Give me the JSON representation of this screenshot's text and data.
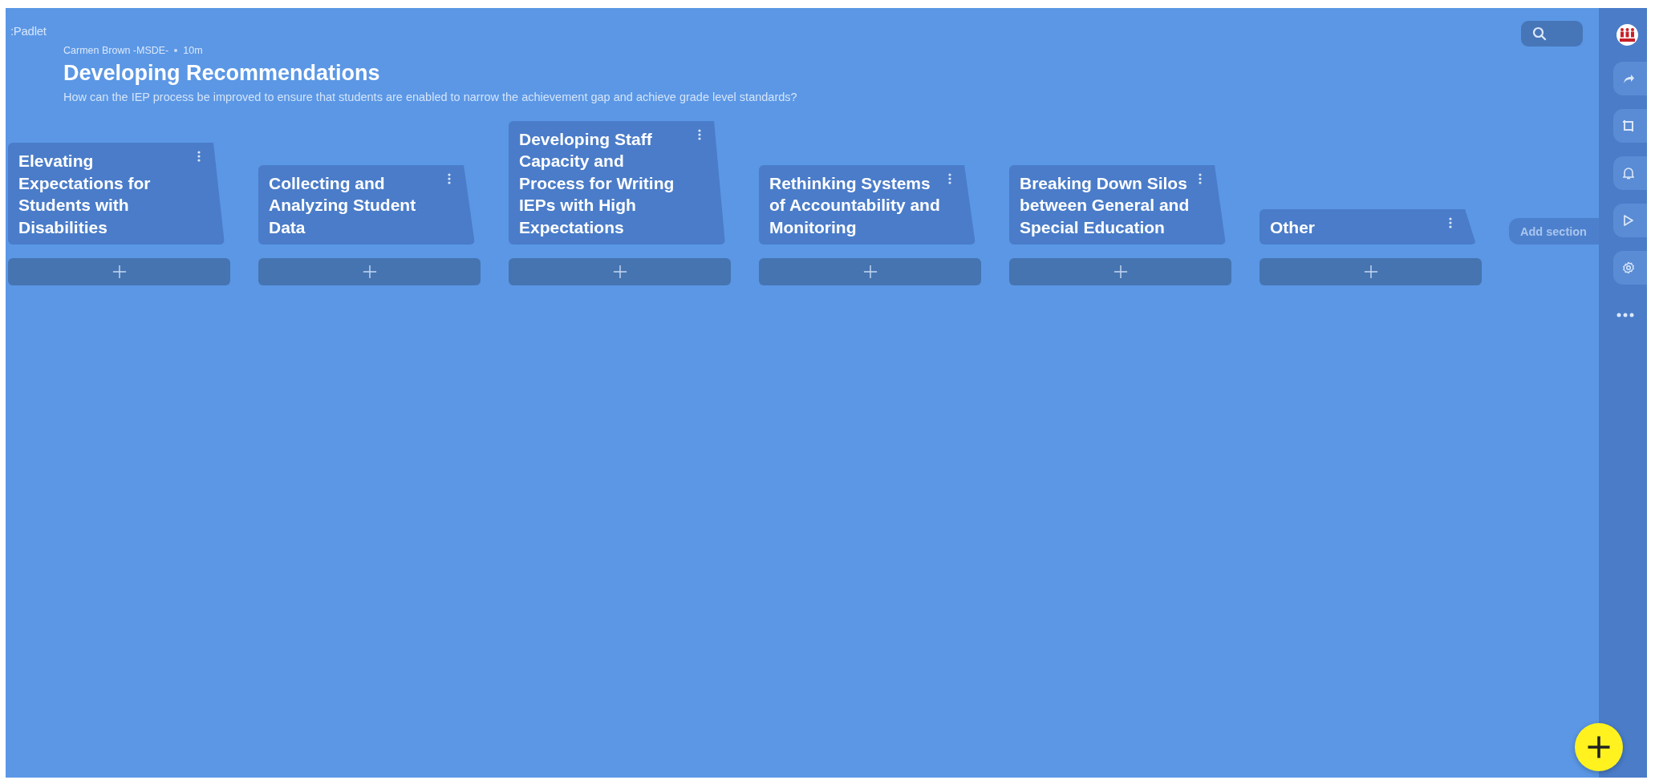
{
  "brand": ":Padlet",
  "author": "Carmen Brown -MSDE-",
  "time": "10m",
  "title": "Developing Recommendations",
  "description": "How can the IEP process be improved to ensure that students are enabled to narrow the achievement gap and achieve grade level standards?",
  "sections": [
    {
      "title": "Elevating Expectations for Students with Disabilities"
    },
    {
      "title": "Collecting and Analyzing Student Data"
    },
    {
      "title": "Developing Staff Capacity and Process for Writing IEPs with High Expectations"
    },
    {
      "title": "Rethinking Systems of Accountability and Monitoring"
    },
    {
      "title": "Breaking Down Silos between General and Special Education"
    },
    {
      "title": "Other"
    }
  ],
  "add_section": "Add section"
}
